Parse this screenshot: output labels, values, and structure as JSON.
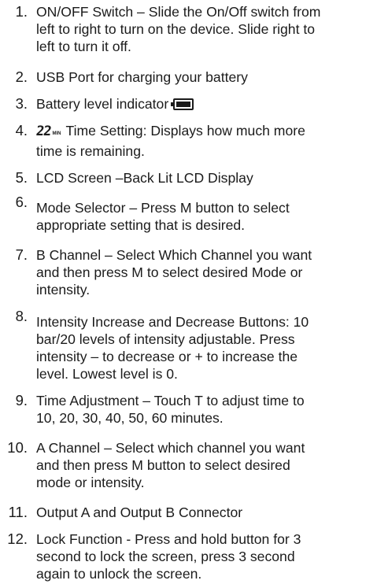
{
  "items": [
    {
      "number": "1.",
      "lines": [
        "ON/OFF Switch – Slide the On/Off switch from",
        "left to right to turn on the device. Slide right to",
        "left to turn it off."
      ]
    },
    {
      "number": "2.",
      "lines": [
        "USB Port for charging your battery"
      ]
    },
    {
      "number": "3.",
      "lines": [
        "Battery level indicator"
      ],
      "icon": "battery-full-icon"
    },
    {
      "number": "4.",
      "display_digits": "22",
      "display_unit": "MIN",
      "lines": [
        "Time Setting: Displays how much more",
        "time is remaining."
      ]
    },
    {
      "number": "5.",
      "lines": [
        "LCD Screen –Back Lit LCD Display"
      ]
    },
    {
      "number": "6.",
      "lines": [
        "Mode Selector – Press M button to select",
        "appropriate setting that is desired."
      ]
    },
    {
      "number": "7.",
      "lines": [
        "B Channel – Select Which Channel you want",
        "and then press M to select desired Mode or",
        "intensity."
      ]
    },
    {
      "number": "8.",
      "lines": [
        "Intensity Increase and Decrease Buttons: 10",
        "bar/20 levels of intensity adjustable. Press",
        "intensity – to decrease or + to increase the",
        "level. Lowest level is 0."
      ]
    },
    {
      "number": "9.",
      "lines": [
        "Time Adjustment – Touch T to adjust time to",
        "10, 20, 30, 40, 50, 60 minutes."
      ]
    },
    {
      "number": "10.",
      "lines": [
        "A Channel – Select which channel you want",
        "and then press M button to select desired",
        "mode or intensity."
      ]
    },
    {
      "number": "11.",
      "lines": [
        "Output A and Output B Connector"
      ]
    },
    {
      "number": "12.",
      "lines": [
        "Lock Function - Press and hold button for 3",
        "second to lock the screen, press 3 second",
        "again to unlock the screen."
      ]
    }
  ]
}
